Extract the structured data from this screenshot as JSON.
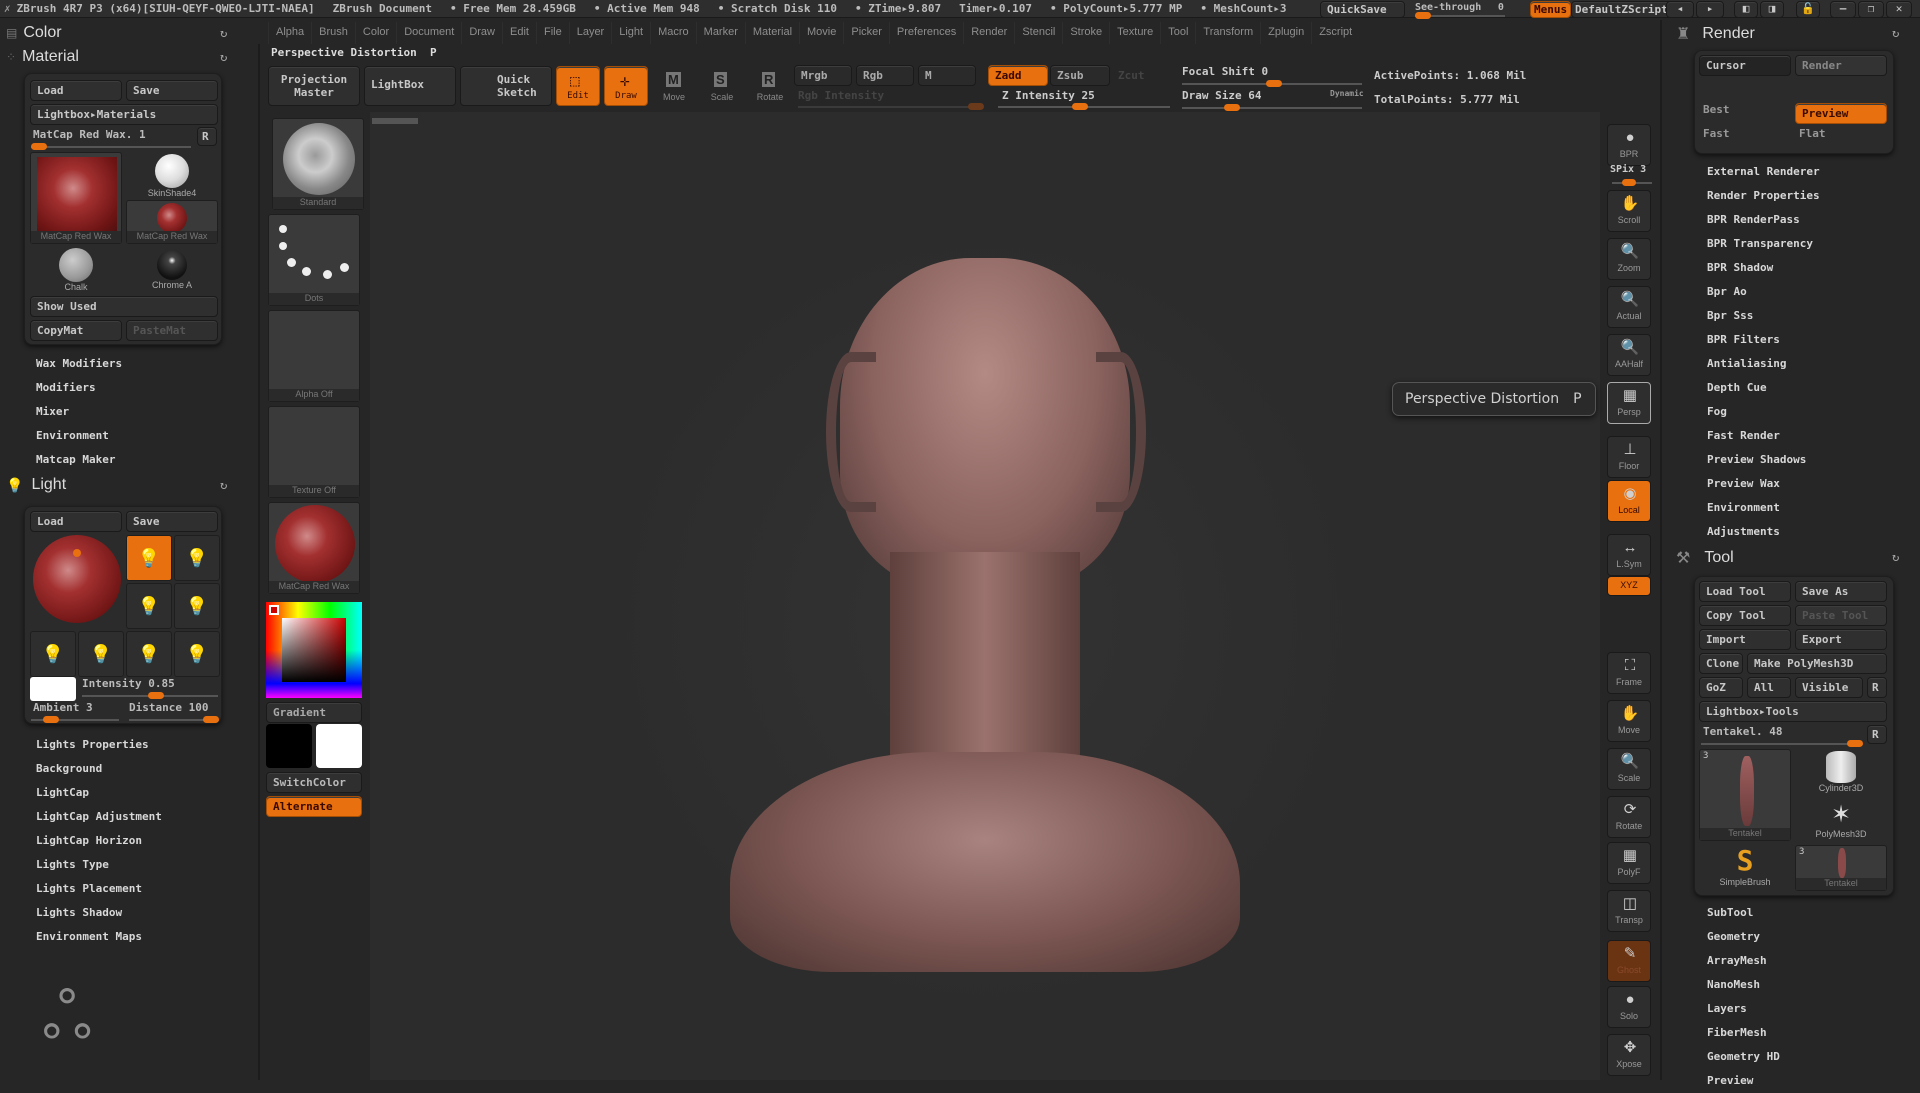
{
  "titlebar": {
    "app": "ZBrush 4R7 P3 (x64)[SIUH-QEYF-QWEO-LJTI-NAEA]",
    "doc": "ZBrush Document",
    "free_mem": "• Free Mem 28.459GB",
    "active_mem": "• Active Mem 948",
    "scratch": "• Scratch Disk 110",
    "ztime": "• ZTime▸9.807",
    "timer": "Timer▸0.107",
    "polycount": "• PolyCount▸5.777 MP",
    "meshcount": "• MeshCount▸3",
    "quicksave": "QuickSave",
    "seethrough": "See-through",
    "seethrough_value": "0",
    "seethrough_fraction": 0.0,
    "menus": "Menus",
    "script": "DefaultZScript"
  },
  "menus": [
    "Alpha",
    "Brush",
    "Color",
    "Document",
    "Draw",
    "Edit",
    "File",
    "Layer",
    "Light",
    "Macro",
    "Marker",
    "Material",
    "Movie",
    "Picker",
    "Preferences",
    "Render",
    "Stencil",
    "Stroke",
    "Texture",
    "Tool",
    "Transform",
    "Zplugin",
    "Zscript"
  ],
  "left": {
    "color_title": "Color",
    "material_title": "Material",
    "load": "Load",
    "save": "Save",
    "lightbox_materials": "Lightbox▸Materials",
    "matcap_name": "MatCap Red Wax. 1",
    "r": "R",
    "mats": [
      "MatCap Red Wax",
      "SkinShade4",
      "MatCap Red Wax",
      "Chalk",
      "Chrome A"
    ],
    "show_used": "Show Used",
    "copymat": "CopyMat",
    "pastemat": "PasteMat",
    "mat_subs": [
      "Wax Modifiers",
      "Modifiers",
      "Mixer",
      "Environment",
      "Matcap Maker"
    ],
    "light_title": "Light",
    "intensity": "Intensity 0.85",
    "intensity_fraction": 0.85,
    "ambient": "Ambient 3",
    "ambient_fraction": 0.03,
    "distance": "Distance 100",
    "distance_fraction": 1.0,
    "light_subs": [
      "Lights Properties",
      "Background",
      "LightCap",
      "LightCap Adjustment",
      "LightCap Horizon",
      "Lights Type",
      "Lights Placement",
      "Lights Shadow",
      "Environment Maps"
    ]
  },
  "shelf": {
    "brush": "Standard",
    "stroke": "Dots",
    "alpha": "Alpha Off",
    "texture": "Texture Off",
    "material": "MatCap Red Wax",
    "gradient": "Gradient",
    "switchcolor": "SwitchColor",
    "alternate": "Alternate"
  },
  "topbar": {
    "label": "Perspective Distortion",
    "hotkey": "P",
    "projection_master": "Projection Master",
    "lightbox": "LightBox",
    "quick_sketch": "Quick Sketch",
    "edit": "Edit",
    "draw": "Draw",
    "move": "Move",
    "scale": "Scale",
    "rotate": "Rotate",
    "mrgb": "Mrgb",
    "rgb": "Rgb",
    "m": "M",
    "zadd": "Zadd",
    "zsub": "Zsub",
    "zcut": "Zcut",
    "rgb_intensity": "Rgb Intensity",
    "z_intensity": "Z Intensity 25",
    "z_intensity_value": 25,
    "focal_shift": "Focal Shift 0",
    "focal_value": 0,
    "draw_size": "Draw Size 64",
    "draw_size_value": 64,
    "dynamic": "Dynamic",
    "active_points": "ActivePoints: 1.068 Mil",
    "total_points": "TotalPoints: 5.777 Mil"
  },
  "tooltip": {
    "text": "Perspective Distortion",
    "key": "P"
  },
  "righttools": [
    "BPR",
    "Scroll",
    "Zoom",
    "Actual",
    "AAHalf",
    "Persp",
    "Floor",
    "Local",
    "L.Sym",
    "XYZ",
    "Frame",
    "Move",
    "Scale",
    "Rotate",
    "PolyF",
    "Transp",
    "Ghost",
    "Solo",
    "Xpose"
  ],
  "spix": "SPix 3",
  "render": {
    "title": "Render",
    "cursor": "Cursor",
    "render": "Render",
    "best": "Best",
    "preview": "Preview",
    "fast": "Fast",
    "flat": "Flat",
    "items": [
      "External Renderer",
      "Render Properties",
      "BPR RenderPass",
      "BPR Transparency",
      "BPR Shadow",
      "Bpr Ao",
      "Bpr Sss",
      "BPR Filters",
      "Antialiasing",
      "Depth Cue",
      "Fog",
      "Fast Render",
      "Preview Shadows",
      "Preview Wax",
      "Environment",
      "Adjustments"
    ]
  },
  "tool": {
    "title": "Tool",
    "load": "Load Tool",
    "save_as": "Save As",
    "copy": "Copy Tool",
    "paste": "Paste Tool",
    "import": "Import",
    "export": "Export",
    "clone": "Clone",
    "make_poly": "Make PolyMesh3D",
    "goz": "GoZ",
    "all": "All",
    "visible": "Visible",
    "r": "R",
    "lightbox_tools": "Lightbox▸Tools",
    "current": "Tentakel. 48",
    "thumbs": [
      "Tentakel",
      "Cylinder3D",
      "PolyMesh3D",
      "SimpleBrush",
      "Tentakel"
    ],
    "count": "3",
    "items": [
      "SubTool",
      "Geometry",
      "ArrayMesh",
      "NanoMesh",
      "Layers",
      "FiberMesh",
      "Geometry HD",
      "Preview"
    ]
  }
}
